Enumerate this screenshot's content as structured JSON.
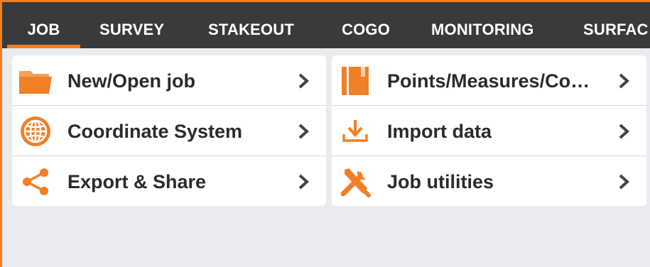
{
  "tabs": [
    {
      "label": "JOB",
      "active": true
    },
    {
      "label": "SURVEY",
      "active": false
    },
    {
      "label": "STAKEOUT",
      "active": false
    },
    {
      "label": "COGO",
      "active": false
    },
    {
      "label": "MONITORING",
      "active": false
    },
    {
      "label": "SURFAC",
      "active": false
    }
  ],
  "colors": {
    "accent": "#f07f26",
    "tabbar_bg": "#3a3a3a",
    "page_bg": "#e9ebee"
  },
  "menu": {
    "left": [
      {
        "label": "New/Open job",
        "icon": "folder-icon"
      },
      {
        "label": "Coordinate System",
        "icon": "globe-icon"
      },
      {
        "label": "Export & Share",
        "icon": "share-icon"
      }
    ],
    "right": [
      {
        "label": "Points/Measures/Co…",
        "icon": "notebook-icon"
      },
      {
        "label": "Import data",
        "icon": "import-icon"
      },
      {
        "label": "Job utilities",
        "icon": "tools-icon"
      }
    ]
  }
}
